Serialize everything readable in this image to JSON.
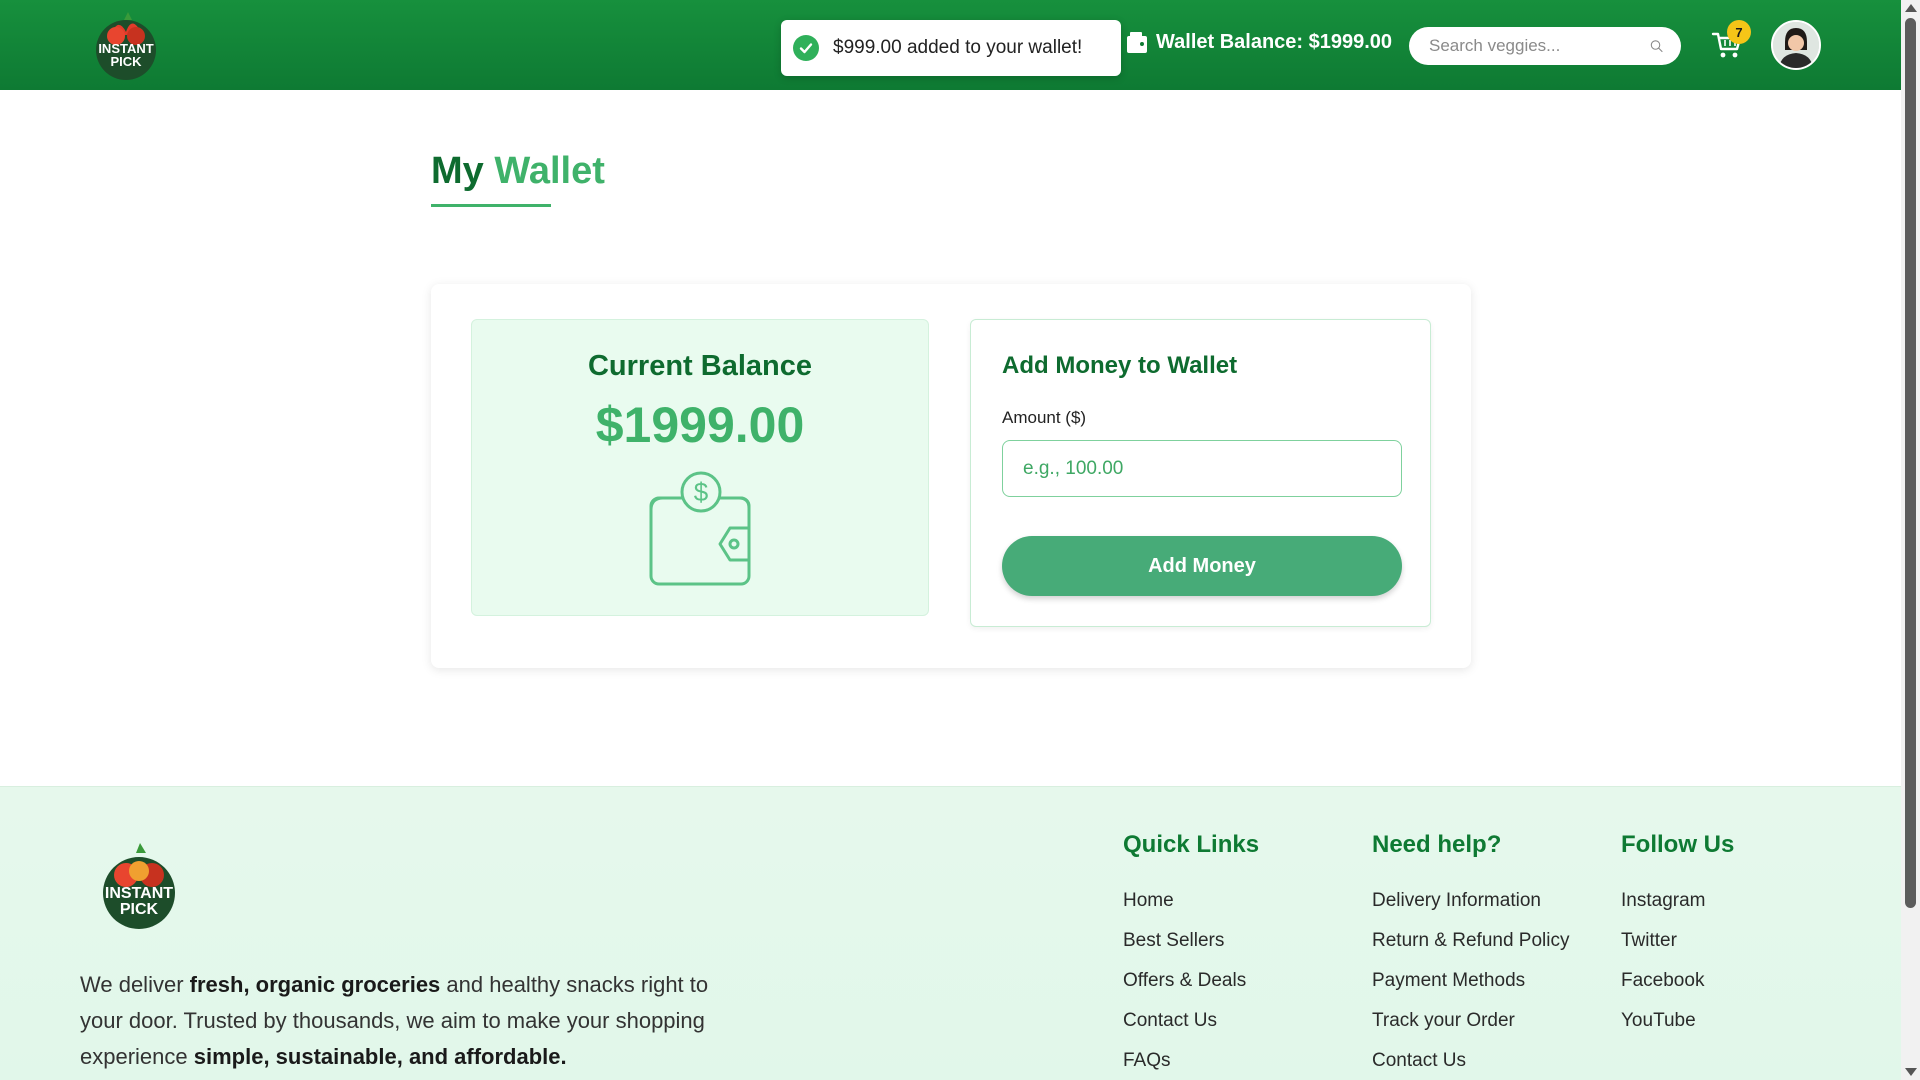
{
  "header": {
    "logo_text": "INSTANT PICK",
    "toast_message": "$999.00 added to your wallet!",
    "wallet_balance_label": "Wallet Balance: $1999.00",
    "search_placeholder": "Search veggies...",
    "cart_count": "7"
  },
  "page": {
    "title_part1": "My",
    "title_part2": "Wallet"
  },
  "balance": {
    "label": "Current Balance",
    "value": "$1999.00"
  },
  "add_money": {
    "title": "Add Money to Wallet",
    "amount_label": "Amount ($)",
    "amount_placeholder": "e.g., 100.00",
    "amount_value": "",
    "button_label": "Add Money"
  },
  "footer": {
    "desc_part1": "We deliver ",
    "desc_bold1": "fresh, organic groceries",
    "desc_part2": " and healthy snacks right to your door. Trusted by thousands, we aim to make your shopping experience ",
    "desc_bold2": "simple, sustainable, and affordable.",
    "quick_links": {
      "title": "Quick Links",
      "items": [
        "Home",
        "Best Sellers",
        "Offers & Deals",
        "Contact Us",
        "FAQs"
      ]
    },
    "need_help": {
      "title": "Need help?",
      "items": [
        "Delivery Information",
        "Return & Refund Policy",
        "Payment Methods",
        "Track your Order",
        "Contact Us"
      ]
    },
    "follow_us": {
      "title": "Follow Us",
      "items": [
        "Instagram",
        "Twitter",
        "Facebook",
        "YouTube"
      ]
    }
  },
  "colors": {
    "header_green": "#17903d",
    "dark_green": "#0e6b2f",
    "accent_green": "#3fb26a",
    "button_green": "#47ab78",
    "badge_yellow": "#f5c518"
  },
  "icons": {
    "toast": "check-circle-icon",
    "wallet_header": "wallet-icon",
    "search": "search-icon",
    "cart": "cart-icon",
    "avatar": "user-avatar",
    "balance_illustration": "wallet-dollar-icon"
  }
}
